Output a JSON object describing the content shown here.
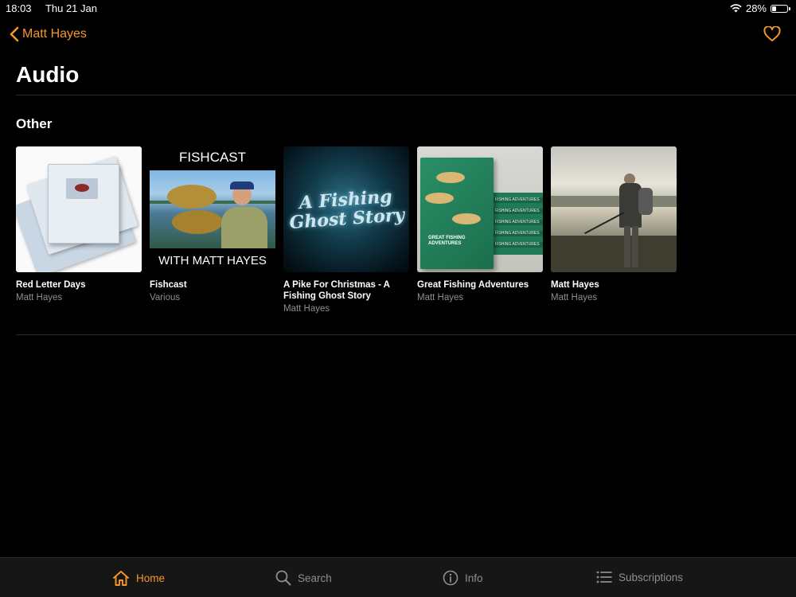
{
  "status_bar": {
    "time": "18:03",
    "date": "Thu 21 Jan",
    "battery": "28%",
    "battery_level": 0.28
  },
  "nav": {
    "back_label": "Matt Hayes"
  },
  "page": {
    "title": "Audio"
  },
  "section": {
    "title": "Other"
  },
  "items": [
    {
      "title": "Red Letter Days",
      "subtitle": "Matt Hayes"
    },
    {
      "title": "Fishcast",
      "subtitle": "Various",
      "art_top": "FISHCAST",
      "art_bottom": "WITH MATT HAYES"
    },
    {
      "title": "A Pike For Christmas - A Fishing Ghost Story",
      "subtitle": "Matt Hayes",
      "art_text_1": "A Fishing",
      "art_text_2": "Ghost Story"
    },
    {
      "title": "Great Fishing Adventures",
      "subtitle": "Matt Hayes",
      "art_cover": "GREAT FISHING ADVENTURES",
      "art_spine": "FISHING ADVENTURES"
    },
    {
      "title": "Matt Hayes",
      "subtitle": "Matt Hayes"
    }
  ],
  "tabs": [
    {
      "label": "Home",
      "icon": "home-icon",
      "active": true
    },
    {
      "label": "Search",
      "icon": "search-icon",
      "active": false
    },
    {
      "label": "Info",
      "icon": "info-icon",
      "active": false
    },
    {
      "label": "Subscriptions",
      "icon": "list-icon",
      "active": false
    }
  ],
  "colors": {
    "accent": "#f5962a",
    "background": "#000000",
    "secondary_text": "#8e8e8e",
    "tabbar": "#161616"
  }
}
